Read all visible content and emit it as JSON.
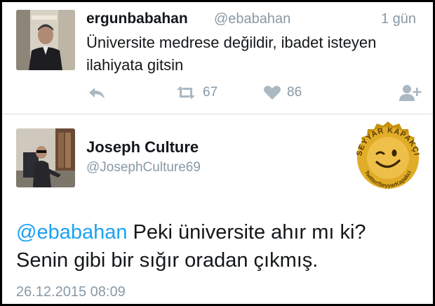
{
  "tweet1": {
    "name": "ergunbabahan",
    "handle": "@ebabahan",
    "time": "1 gün",
    "text": "Üniversite medrese değildir, ibadet isteyen ilahiyata gitsin",
    "retweet_count": "67",
    "like_count": "86",
    "icons": [
      "reply-icon",
      "retweet-icon",
      "heart-icon",
      "follow-icon"
    ]
  },
  "tweet2": {
    "name": "Joseph Culture",
    "handle": "@JosephCulture69",
    "mention": "@ebabahan",
    "text_line1": " Peki üniversite ahır mı ki?",
    "text_line2": "Senin gibi bir sığır oradan çıkmış.",
    "date": "26.12.2015 08:09"
  },
  "watermark": {
    "top_text": "SEYYAR KAPAKÇI",
    "bottom_text": "Twitter/SeyyarKapakci"
  },
  "colors": {
    "link": "#1da1f2",
    "muted": "#8899a6",
    "icon": "#aab8c2",
    "cap_gold": "#d9a61b"
  }
}
